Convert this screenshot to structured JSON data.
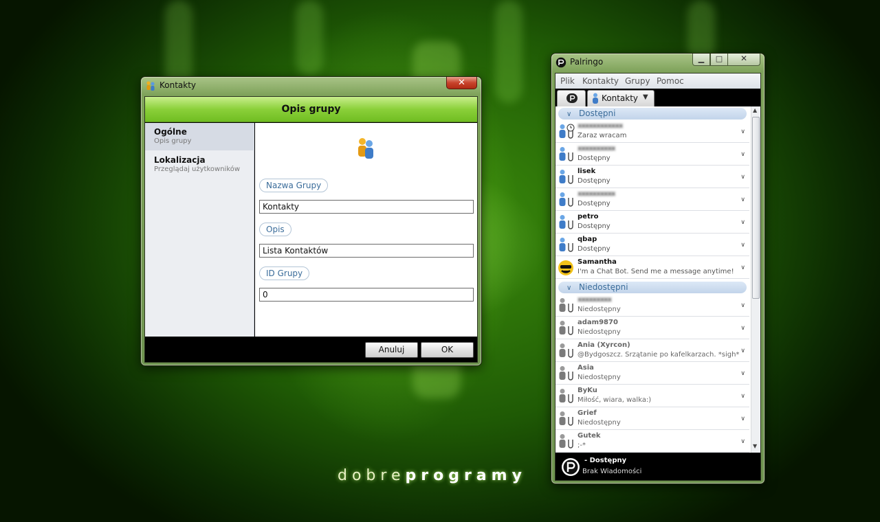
{
  "desktop": {
    "watermark_light": "dobre",
    "watermark_bold": "programy"
  },
  "kontakty_window": {
    "title": "Kontakty",
    "header": "Opis grupy",
    "sidebar": [
      {
        "label": "Ogólne",
        "sub": "Opis grupy"
      },
      {
        "label": "Lokalizacja",
        "sub": "Przeglądaj użytkowników"
      }
    ],
    "fields": {
      "name_label": "Nazwa Grupy",
      "name_value": "Kontakty",
      "desc_label": "Opis",
      "desc_value": "Lista Kontaktów",
      "id_label": "ID Grupy",
      "id_value": "0"
    },
    "buttons": {
      "cancel": "Anuluj",
      "ok": "OK"
    }
  },
  "palringo_window": {
    "title": "Palringo",
    "menu": [
      "Plik",
      "Kontakty",
      "Grupy",
      "Pomoc"
    ],
    "tab_label": "Kontakty",
    "groups": {
      "online": "Dostępni",
      "offline": "Niedostępni"
    },
    "online_contacts": [
      {
        "name": "xxxxxxxxxxxx",
        "status": "Zaraz wracam",
        "redacted": true
      },
      {
        "name": "xxxxxxxxxx",
        "status": "Dostępny",
        "redacted": true
      },
      {
        "name": "lisek",
        "status": "Dostępny"
      },
      {
        "name": "xxxxxxxxxx",
        "status": "Dostępny",
        "redacted": true
      },
      {
        "name": "petro",
        "status": "Dostępny"
      },
      {
        "name": "qbap",
        "status": "Dostępny"
      },
      {
        "name": "Samantha",
        "status": "I'm a Chat Bot. Send me a message anytime!"
      }
    ],
    "offline_contacts": [
      {
        "name": "xxxxxxxxx",
        "status": "Niedostępny",
        "redacted": true
      },
      {
        "name": "adam9870",
        "status": "Niedostępny"
      },
      {
        "name": "Ania (Xyrcon)",
        "status": "@Bydgoszcz. Srzątanie po kafelkarzach. *sigh*"
      },
      {
        "name": "Asia",
        "status": "Niedostępny"
      },
      {
        "name": "ByKu",
        "status": "Miłość, wiara, walka:)"
      },
      {
        "name": "Grief",
        "status": "Niedostępny"
      },
      {
        "name": "Gutek",
        "status": ";-*"
      }
    ],
    "self_status": "- Dostępny",
    "self_message": "Brak Wiadomości"
  },
  "colors": {
    "accent_green": "#8bd03a",
    "group_blue": "#3a6c9a",
    "close_red": "#c8432c"
  }
}
